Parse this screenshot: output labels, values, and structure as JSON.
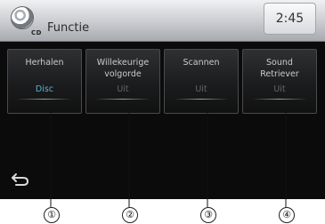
{
  "header": {
    "icon": "cd-icon",
    "icon_text": "CD",
    "title": "Functie",
    "time": "2:45"
  },
  "options": [
    {
      "label_lines": [
        "Herhalen",
        ""
      ],
      "value": "Disc",
      "active": true
    },
    {
      "label_lines": [
        "Willekeurige",
        "volgorde"
      ],
      "value": "Uit",
      "active": false
    },
    {
      "label_lines": [
        "Scannen",
        ""
      ],
      "value": "Uit",
      "active": false
    },
    {
      "label_lines": [
        "Sound",
        "Retriever"
      ],
      "value": "Uit",
      "active": false
    }
  ],
  "back_button": {
    "icon": "back-arrow-icon"
  },
  "callouts": [
    "①",
    "②",
    "③",
    "④"
  ],
  "colors": {
    "active_value": "#58b6d6",
    "inactive_value": "#646669",
    "background": "#0b0b0c"
  }
}
